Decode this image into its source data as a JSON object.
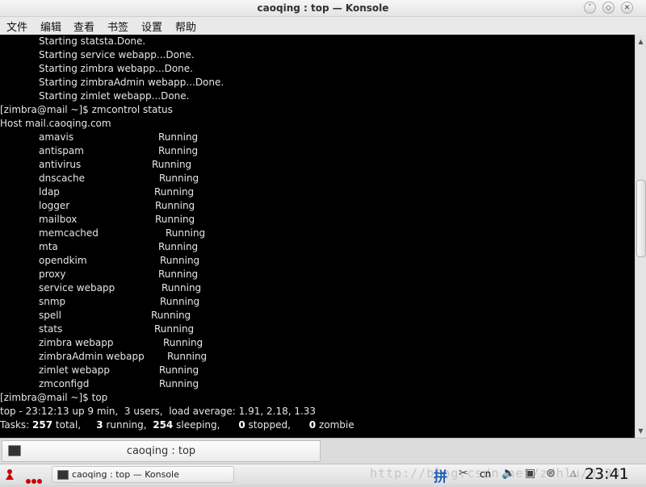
{
  "window": {
    "title": "caoqing : top — Konsole"
  },
  "menu": [
    "文件",
    "编辑",
    "查看",
    "书签",
    "设置",
    "帮助"
  ],
  "terminal": {
    "startup_lines": [
      "Starting statsta.Done.",
      "Starting service webapp...Done.",
      "Starting zimbra webapp...Done.",
      "Starting zimbraAdmin webapp...Done.",
      "Starting zimlet webapp...Done."
    ],
    "prompt1": "[zimbra@mail ~]$ zmcontrol status",
    "host_line": "Host mail.caoqing.com",
    "services": [
      {
        "name": "amavis",
        "state": "Running"
      },
      {
        "name": "antispam",
        "state": "Running"
      },
      {
        "name": "antivirus",
        "state": "Running"
      },
      {
        "name": "dnscache",
        "state": "Running"
      },
      {
        "name": "ldap",
        "state": "Running"
      },
      {
        "name": "logger",
        "state": "Running"
      },
      {
        "name": "mailbox",
        "state": "Running"
      },
      {
        "name": "memcached",
        "state": "Running"
      },
      {
        "name": "mta",
        "state": "Running"
      },
      {
        "name": "opendkim",
        "state": "Running"
      },
      {
        "name": "proxy",
        "state": "Running"
      },
      {
        "name": "service webapp",
        "state": "Running"
      },
      {
        "name": "snmp",
        "state": "Running"
      },
      {
        "name": "spell",
        "state": "Running"
      },
      {
        "name": "stats",
        "state": "Running"
      },
      {
        "name": "zimbra webapp",
        "state": "Running"
      },
      {
        "name": "zimbraAdmin webapp",
        "state": "Running"
      },
      {
        "name": "zimlet webapp",
        "state": "Running"
      },
      {
        "name": "zmconfigd",
        "state": "Running"
      }
    ],
    "prompt2": "[zimbra@mail ~]$ top",
    "top_line": "top - 23:12:13 up 9 min,  3 users,  load average: 1.91, 2.18, 1.33",
    "tasks": {
      "label": "Tasks:",
      "total": "257",
      "total_label": "total,",
      "running": "3",
      "running_label": "running,",
      "sleeping": "254",
      "sleeping_label": "sleeping,",
      "stopped": "0",
      "stopped_label": "stopped,",
      "zombie": "0",
      "zombie_label": "zombie"
    }
  },
  "tab": {
    "label": "caoqing : top"
  },
  "panel": {
    "task_label": "caoqing : top — Konsole",
    "watermark": "http://blog.csdn.net/zdhlu/01231",
    "ime_label": "拼",
    "lang_label": "cn",
    "clock": "23:41"
  }
}
